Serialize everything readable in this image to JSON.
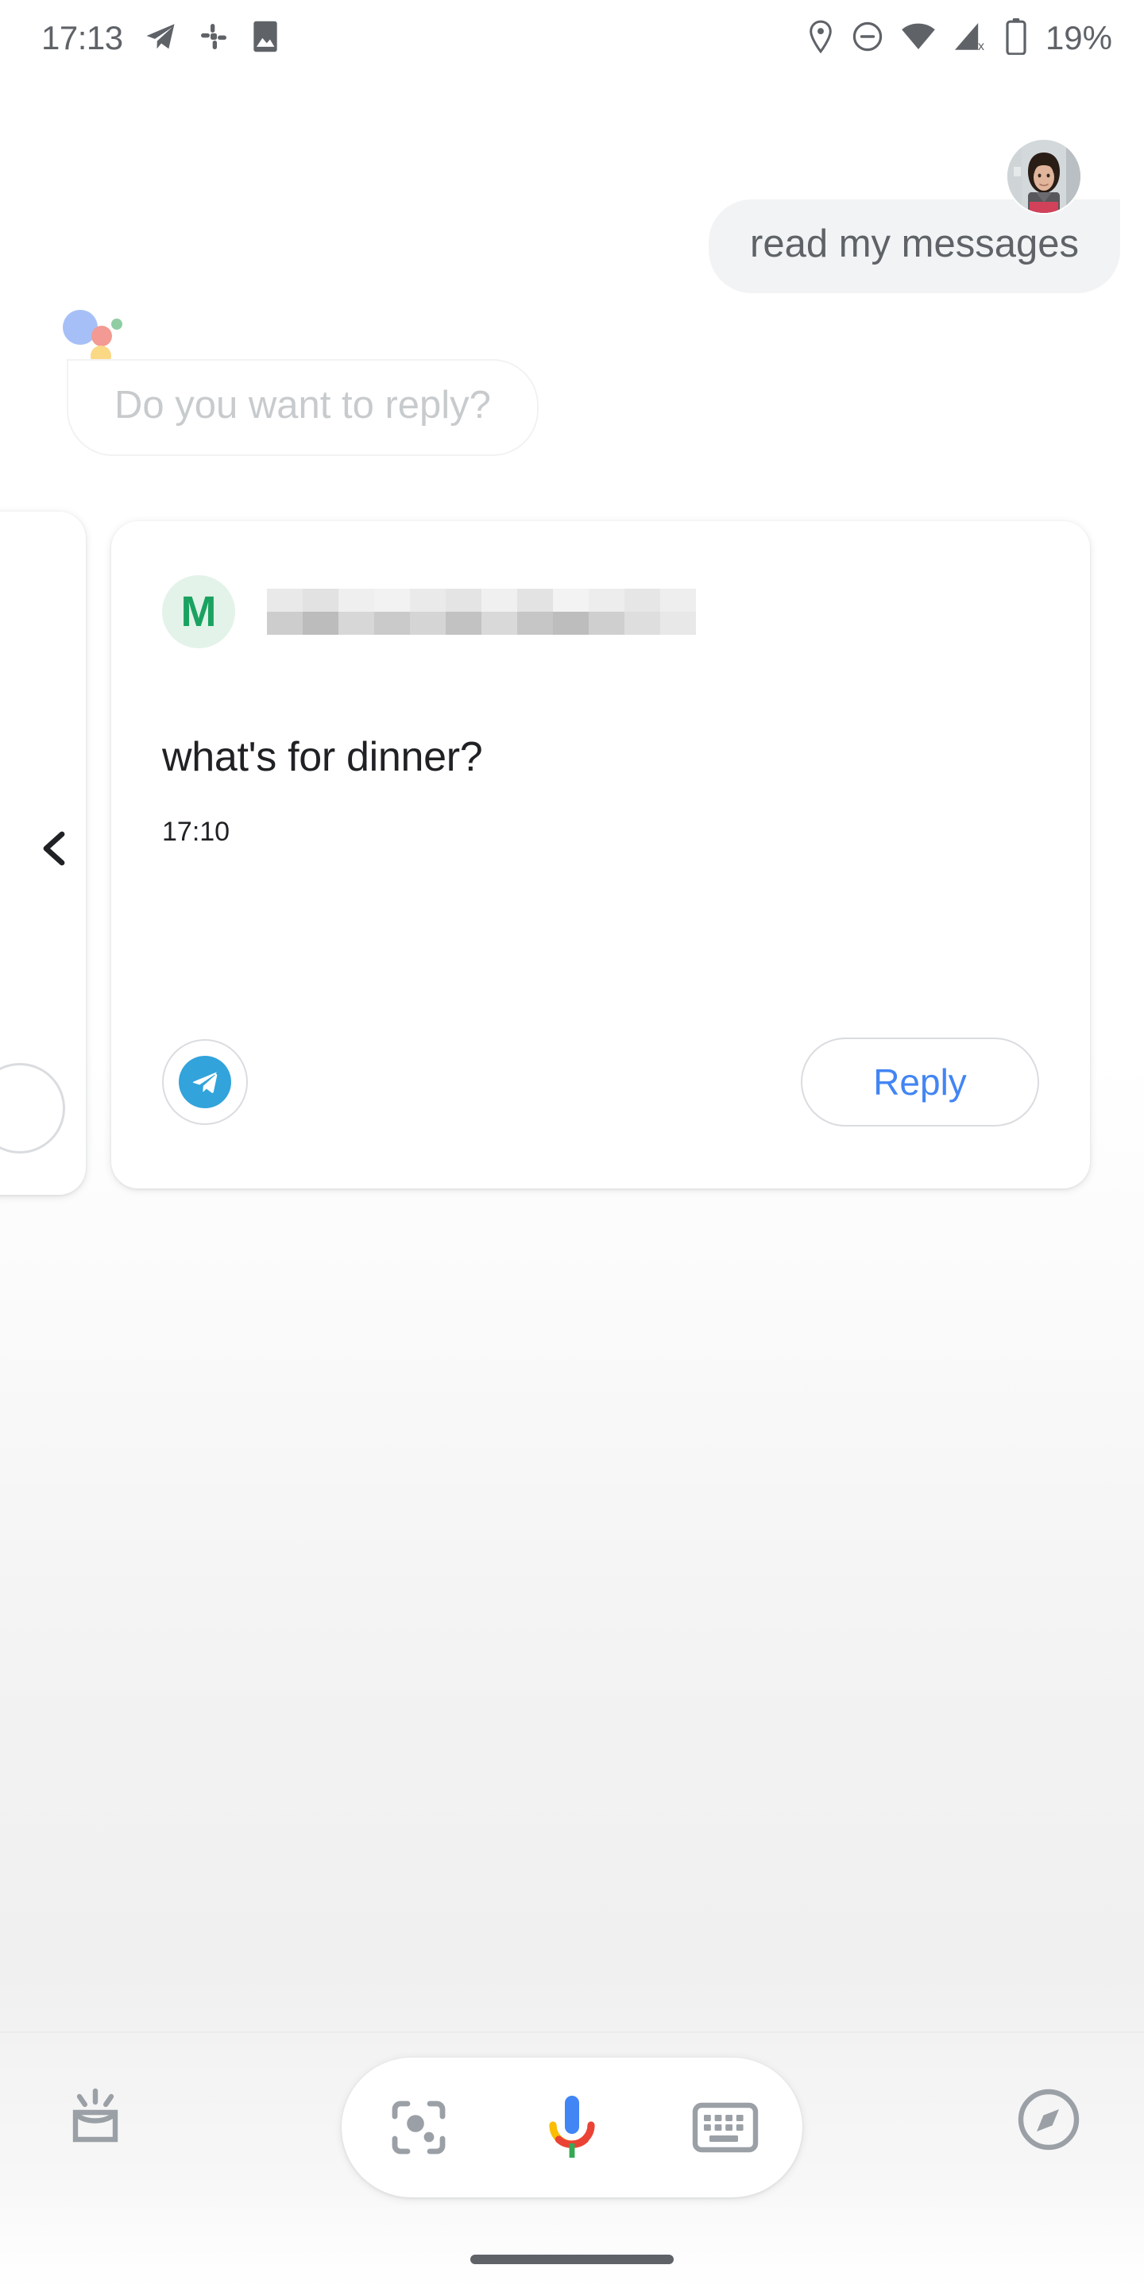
{
  "status_bar": {
    "time": "17:13",
    "battery_percent": "19%",
    "left_icons": [
      "telegram-icon",
      "slack-icon",
      "photo-icon"
    ],
    "right_icons": [
      "location-pin-icon",
      "do-not-disturb-icon",
      "wifi-icon",
      "mobile-signal-off-icon",
      "battery-icon"
    ]
  },
  "conversation": {
    "user": {
      "avatar": "user-avatar-photo",
      "message": "read my messages"
    },
    "assistant": {
      "logo": "google-assistant-dots-icon",
      "prompt": "Do you want to reply?"
    }
  },
  "card": {
    "sender_initial": "M",
    "sender_name_redacted": true,
    "message": "what's for dinner?",
    "time": "17:10",
    "app_icon": "telegram-icon",
    "reply_label": "Reply",
    "prev_card_chevron": "chevron-left-icon"
  },
  "bottom_bar": {
    "snapshot_icon": "assistant-snapshot-icon",
    "lens_icon": "google-lens-icon",
    "mic_icon": "google-mic-icon",
    "keyboard_icon": "keyboard-icon",
    "explore_icon": "compass-explore-icon",
    "gesture_bar": "home-gesture-bar"
  },
  "colors": {
    "assistant_blue": "#4285f4",
    "assistant_red": "#ea4335",
    "assistant_yellow": "#fbbc04",
    "assistant_green": "#34a853",
    "telegram_blue": "#32a3db",
    "sender_green": "#1aa260",
    "sender_avatar_bg": "#e3f3e9",
    "user_bubble_bg": "#f1f3f4",
    "muted_text": "#5f6368"
  }
}
